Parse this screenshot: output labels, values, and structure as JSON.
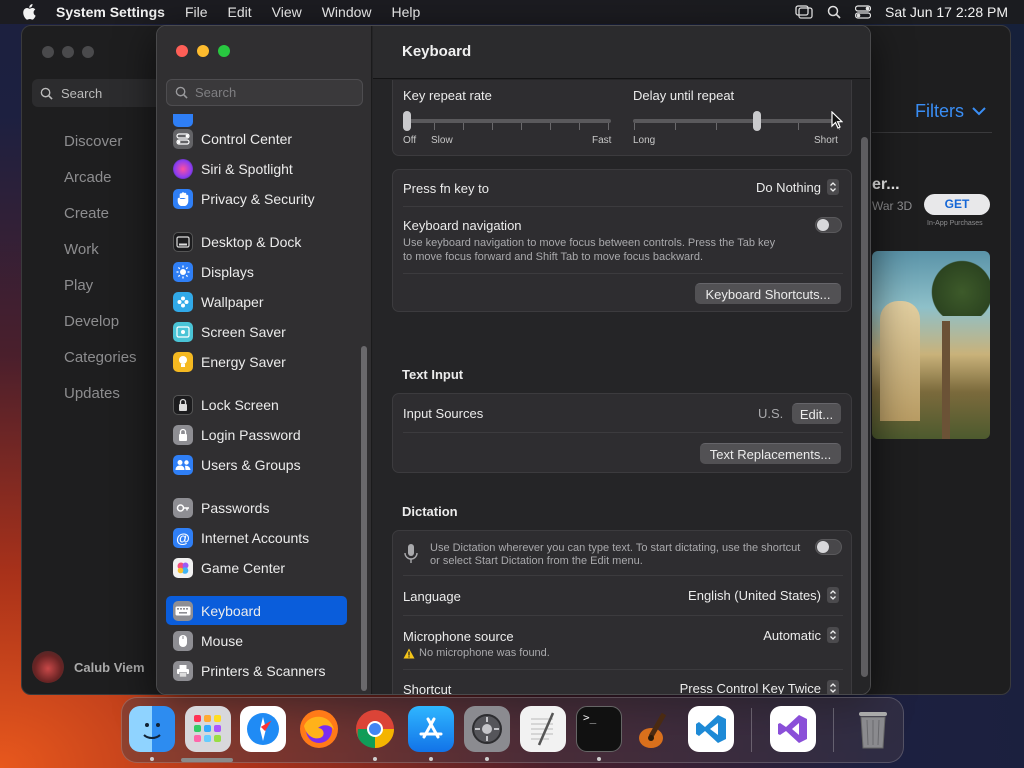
{
  "menubar": {
    "app_name": "System Settings",
    "items": [
      "File",
      "Edit",
      "View",
      "Window",
      "Help"
    ],
    "clock": "Sat Jun 17  2:28 PM"
  },
  "bg_window": {
    "search_label": "Search",
    "nav": [
      "Discover",
      "Arcade",
      "Create",
      "Work",
      "Play",
      "Develop",
      "Categories",
      "Updates"
    ],
    "user_name": "Calub Viem",
    "filters_label": "Filters",
    "game_title": "er...",
    "game_subtitle": "War 3D",
    "get_label": "GET",
    "in_app_label": "In-App Purchases"
  },
  "sidebar": {
    "search_placeholder": "Search",
    "items": [
      {
        "label": "Control Center",
        "icon": "control-center-icon",
        "color": "#636366"
      },
      {
        "label": "Siri & Spotlight",
        "icon": "siri-icon",
        "color": "#c03fd8"
      },
      {
        "label": "Privacy & Security",
        "icon": "hand-icon",
        "color": "#2f7ff6"
      },
      {
        "label": "Desktop & Dock",
        "icon": "dock-icon",
        "color": "#1c1c1e"
      },
      {
        "label": "Displays",
        "icon": "sun-icon",
        "color": "#2f7ff6"
      },
      {
        "label": "Wallpaper",
        "icon": "flower-icon",
        "color": "#31a9e8"
      },
      {
        "label": "Screen Saver",
        "icon": "screen-saver-icon",
        "color": "#4ac4d6"
      },
      {
        "label": "Energy Saver",
        "icon": "bulb-icon",
        "color": "#f5b921"
      },
      {
        "label": "Lock Screen",
        "icon": "lock-icon",
        "color": "#1c1c1e"
      },
      {
        "label": "Login Password",
        "icon": "lock-icon",
        "color": "#8e8e93"
      },
      {
        "label": "Users & Groups",
        "icon": "users-icon",
        "color": "#2f7ff6"
      },
      {
        "label": "Passwords",
        "icon": "key-icon",
        "color": "#8e8e93"
      },
      {
        "label": "Internet Accounts",
        "icon": "at-icon",
        "color": "#2f7ff6"
      },
      {
        "label": "Game Center",
        "icon": "game-center-icon",
        "color": "#f2f2f2"
      },
      {
        "label": "Keyboard",
        "icon": "keyboard-icon",
        "color": "#8e8e93"
      },
      {
        "label": "Mouse",
        "icon": "mouse-icon",
        "color": "#8e8e93"
      },
      {
        "label": "Printers & Scanners",
        "icon": "printer-icon",
        "color": "#8e8e93"
      }
    ]
  },
  "content": {
    "title": "Keyboard",
    "key_repeat": {
      "label": "Key repeat rate",
      "off": "Off",
      "slow": "Slow",
      "fast": "Fast",
      "level": 0.0
    },
    "delay_repeat": {
      "label": "Delay until repeat",
      "long": "Long",
      "short": "Short",
      "level": 0.6
    },
    "fn_key": {
      "label": "Press fn key to",
      "value": "Do Nothing"
    },
    "keyboard_nav": {
      "label": "Keyboard navigation",
      "desc1": "Use keyboard navigation to move focus between controls. Press the Tab key",
      "desc2": "to move focus forward and Shift Tab to move focus backward.",
      "enabled": false
    },
    "shortcuts_btn": "Keyboard Shortcuts...",
    "text_input": {
      "title": "Text Input",
      "sources_label": "Input Sources",
      "sources_value": "U.S.",
      "edit_btn": "Edit...",
      "replacements_btn": "Text Replacements..."
    },
    "dictation": {
      "title": "Dictation",
      "desc1": "Use Dictation wherever you can type text. To start dictating, use the shortcut",
      "desc2": "or select Start Dictation from the Edit menu.",
      "enabled": false,
      "language_label": "Language",
      "language_value": "English (United States)",
      "mic_label": "Microphone source",
      "mic_value": "Automatic",
      "mic_warning": "No microphone was found.",
      "shortcut_label": "Shortcut",
      "shortcut_value": "Press Control Key Twice"
    }
  },
  "dock": {
    "apps": [
      "finder-icon",
      "launchpad-icon",
      "safari-icon",
      "firefox-icon",
      "chrome-icon",
      "app-store-icon",
      "system-settings-icon",
      "textedit-icon",
      "terminal-icon",
      "garageband-icon",
      "vscode-icon",
      "visual-studio-icon",
      "trash-icon"
    ]
  }
}
